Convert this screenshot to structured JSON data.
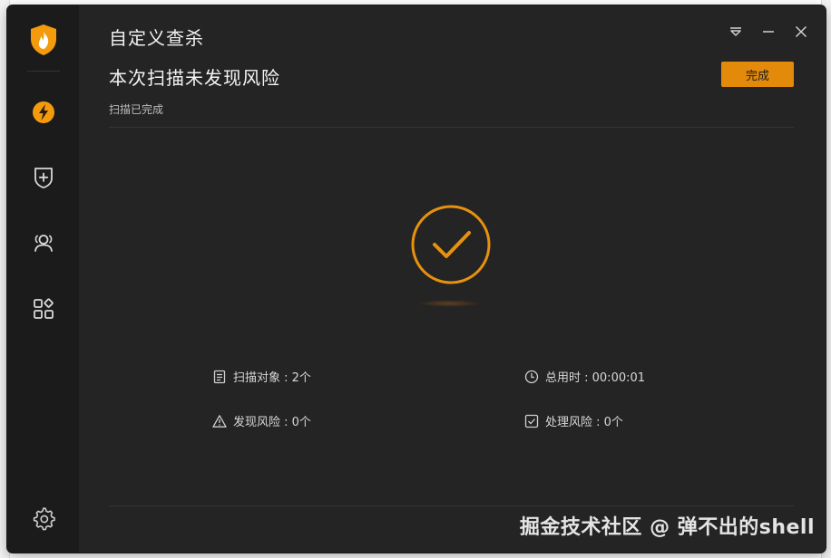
{
  "window": {
    "title": "自定义查杀",
    "headline": "本次扫描未发现风险",
    "subline": "扫描已完成",
    "done_label": "完成"
  },
  "sidebar": {
    "items": [
      {
        "icon": "lightning-icon"
      },
      {
        "icon": "shield-plus-icon"
      },
      {
        "icon": "users-icon"
      },
      {
        "icon": "apps-grid-icon"
      }
    ],
    "settings_icon": "gear-icon"
  },
  "stats": {
    "scanned_label": "扫描对象 : 2个",
    "duration_label": "总用时 : 00:00:01",
    "risks_found_label": "发现风险 : 0个",
    "risks_handled_label": "处理风险 : 0个"
  },
  "watermark": "掘金技术社区 @ 弹不出的shell",
  "colors": {
    "accent": "#e38a0a",
    "window_bg": "#242424",
    "sidebar_bg": "#1b1b1b"
  }
}
